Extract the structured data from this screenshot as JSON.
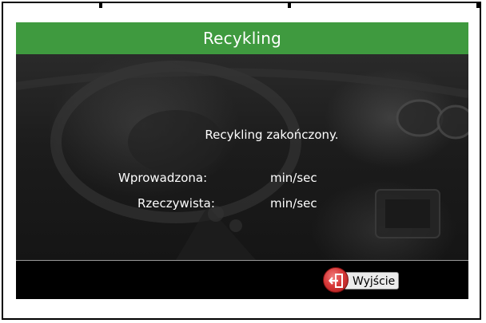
{
  "window": {
    "title": "Recykling"
  },
  "main": {
    "message": "Recykling zakończony.",
    "rows": [
      {
        "label": "Wprowadzona:",
        "value": "min/sec"
      },
      {
        "label": "Rzeczywista:",
        "value": "min/sec"
      }
    ]
  },
  "footer": {
    "exit_label": "Wyjście",
    "exit_icon": "exit-door-icon"
  },
  "colors": {
    "title_bar": "#3f9a3f",
    "exit_button": "#d83a3a",
    "background": "#000000"
  }
}
